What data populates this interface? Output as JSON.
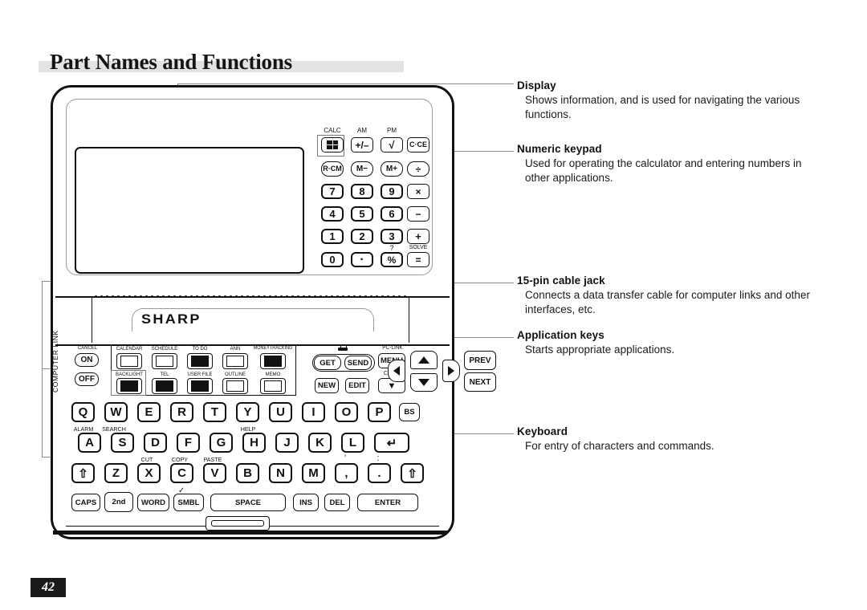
{
  "document": {
    "title": "Part Names and Functions",
    "page_number": "42"
  },
  "callouts": [
    {
      "id": "display",
      "heading": "Display",
      "body": "Shows information, and is used for navigating the various functions."
    },
    {
      "id": "numeric_keypad",
      "heading": "Numeric keypad",
      "body": "Used for operating the calculator and entering numbers in other applications."
    },
    {
      "id": "cable_jack",
      "heading": "15-pin cable jack",
      "body": "Connects a data transfer cable for computer links and other interfaces, etc."
    },
    {
      "id": "application_keys",
      "heading": "Application keys",
      "body": "Starts appropriate applications."
    },
    {
      "id": "keyboard",
      "heading": "Keyboard",
      "body": "For entry of characters and commands."
    }
  ],
  "device": {
    "brand": "SHARP",
    "side_label": "COMPUTER LINK",
    "numeric_keypad": {
      "top_labels": {
        "calc": "CALC",
        "am": "AM",
        "pm": "PM"
      },
      "rows": [
        [
          {
            "label": "",
            "icon": "calculator-icon"
          },
          {
            "label": "+/–"
          },
          {
            "label": "√"
          },
          {
            "label": "C·CE"
          }
        ],
        [
          {
            "label": "R·CM"
          },
          {
            "label": "M−"
          },
          {
            "label": "M+"
          },
          {
            "label": "÷"
          }
        ],
        [
          {
            "label": "7"
          },
          {
            "label": "8"
          },
          {
            "label": "9"
          },
          {
            "label": "×"
          }
        ],
        [
          {
            "label": "4"
          },
          {
            "label": "5"
          },
          {
            "label": "6"
          },
          {
            "label": "−"
          }
        ],
        [
          {
            "label": "1"
          },
          {
            "label": "2"
          },
          {
            "label": "3"
          },
          {
            "label": "+"
          }
        ],
        [
          {
            "label": "0"
          },
          {
            "label": "·"
          },
          {
            "label": "%"
          },
          {
            "label": "="
          }
        ]
      ],
      "bottom_labels": {
        "percent_shift": "?",
        "equals_shift": "SOLVE"
      }
    },
    "power": {
      "group_label": "CANCEL",
      "on": "ON",
      "off": "OFF"
    },
    "application_keys": {
      "row1": [
        {
          "label": "CALENDAR",
          "icon": "calendar-icon"
        },
        {
          "label": "SCHEDULE",
          "icon": "schedule-icon"
        },
        {
          "label": "TO DO",
          "icon": "todo-icon"
        },
        {
          "label": "ANN",
          "icon": "anniversary-icon"
        },
        {
          "label": "MONEYTRACKING",
          "icon": "money-icon"
        }
      ],
      "row2": [
        {
          "label": "BACKLIGHT",
          "icon": "backlight-icon"
        },
        {
          "label": "TEL",
          "icon": "telephone-icon"
        },
        {
          "label": "USER FILE",
          "icon": "userfile-icon"
        },
        {
          "label": "OUTLINE",
          "icon": "outline-icon"
        },
        {
          "label": "MEMO",
          "icon": "memo-icon"
        }
      ]
    },
    "link_keys": {
      "phone_icon": "phone-icon",
      "get": "GET",
      "send": "SEND",
      "new": "NEW",
      "edit": "EDIT",
      "pc_link_label": "PC-LINK",
      "menu": "MENU",
      "clock_label": "CLOCK",
      "clock_key": "▼"
    },
    "navigation": {
      "up": "▲",
      "down": "▼",
      "left": "◀",
      "right": "▶",
      "prev": "PREV",
      "next": "NEXT"
    },
    "keyboard": {
      "row1": [
        {
          "key": "Q"
        },
        {
          "key": "W"
        },
        {
          "key": "E"
        },
        {
          "key": "R"
        },
        {
          "key": "T"
        },
        {
          "key": "Y"
        },
        {
          "key": "U"
        },
        {
          "key": "I"
        },
        {
          "key": "O"
        },
        {
          "key": "P"
        },
        {
          "key": "BS"
        }
      ],
      "row2": [
        {
          "key": "A",
          "shift": "ALARM"
        },
        {
          "key": "S",
          "shift": "SEARCH"
        },
        {
          "key": "D"
        },
        {
          "key": "F"
        },
        {
          "key": "G"
        },
        {
          "key": "H",
          "shift": "HELP"
        },
        {
          "key": "J"
        },
        {
          "key": "K"
        },
        {
          "key": "L"
        },
        {
          "key": "↵"
        }
      ],
      "row3": [
        {
          "key": "⇧"
        },
        {
          "key": "Z"
        },
        {
          "key": "X",
          "shift": "CUT"
        },
        {
          "key": "C",
          "shift": "COPY"
        },
        {
          "key": "V",
          "shift": "PASTE"
        },
        {
          "key": "B"
        },
        {
          "key": "N"
        },
        {
          "key": "M"
        },
        {
          "key": ",",
          "shift": "’"
        },
        {
          "key": ".",
          "shift": ":"
        },
        {
          "key": "⇧"
        }
      ],
      "row4": [
        {
          "key": "CAPS"
        },
        {
          "key": "2nd"
        },
        {
          "key": "WORD"
        },
        {
          "key": "SMBL",
          "shift": "✓"
        },
        {
          "key": "SPACE"
        },
        {
          "key": "INS"
        },
        {
          "key": "DEL"
        },
        {
          "key": "ENTER"
        }
      ]
    }
  }
}
